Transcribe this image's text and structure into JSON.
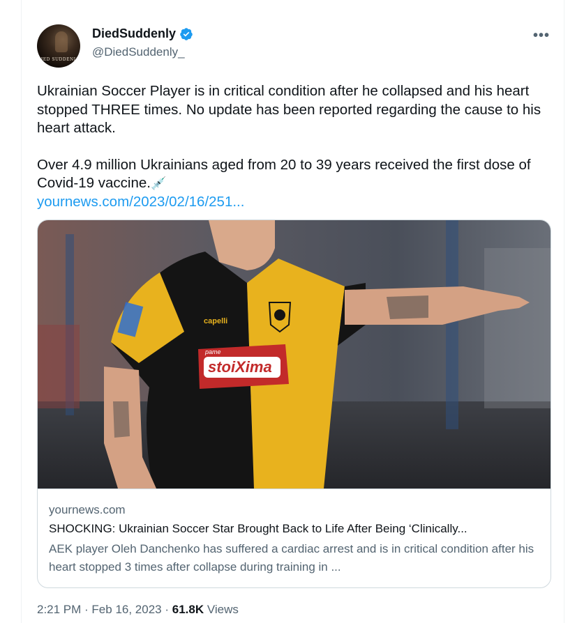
{
  "author": {
    "name": "DiedSuddenly",
    "handle": "@DiedSuddenly_",
    "avatar_text": "DIED SUDDENLY",
    "verified": true
  },
  "more_label": "•••",
  "tweet": {
    "paragraph1": "Ukrainian Soccer Player is in critical condition after he collapsed and his heart stopped THREE times. No update has been reported regarding the cause to his heart attack.",
    "paragraph2": "Over 4.9 million Ukrainians aged from 20 to 39 years received the first dose of Covid-19 vaccine.",
    "emoji": "💉",
    "link": "yournews.com/2023/02/16/251..."
  },
  "card": {
    "domain": "yournews.com",
    "title": "SHOCKING: Ukrainian Soccer Star Brought Back to Life After Being ‘Clinically...",
    "description": "AEK player Oleh Danchenko has suffered a cardiac arrest and is in critical condition after his heart stopped 3 times after collapse during training in ...",
    "image_text": {
      "sponsor_top": "pame",
      "sponsor": "stoiXima",
      "brand": "capelli"
    }
  },
  "footer": {
    "time": "2:21 PM",
    "sep1": " · ",
    "date": "Feb 16, 2023",
    "sep2": " · ",
    "views_count": "61.8K",
    "views_label": " Views"
  },
  "colors": {
    "accent": "#1d9bf0",
    "secondary_text": "#536471",
    "border": "#cfd9de",
    "jersey_yellow": "#e8b21e",
    "jersey_black": "#141414"
  }
}
